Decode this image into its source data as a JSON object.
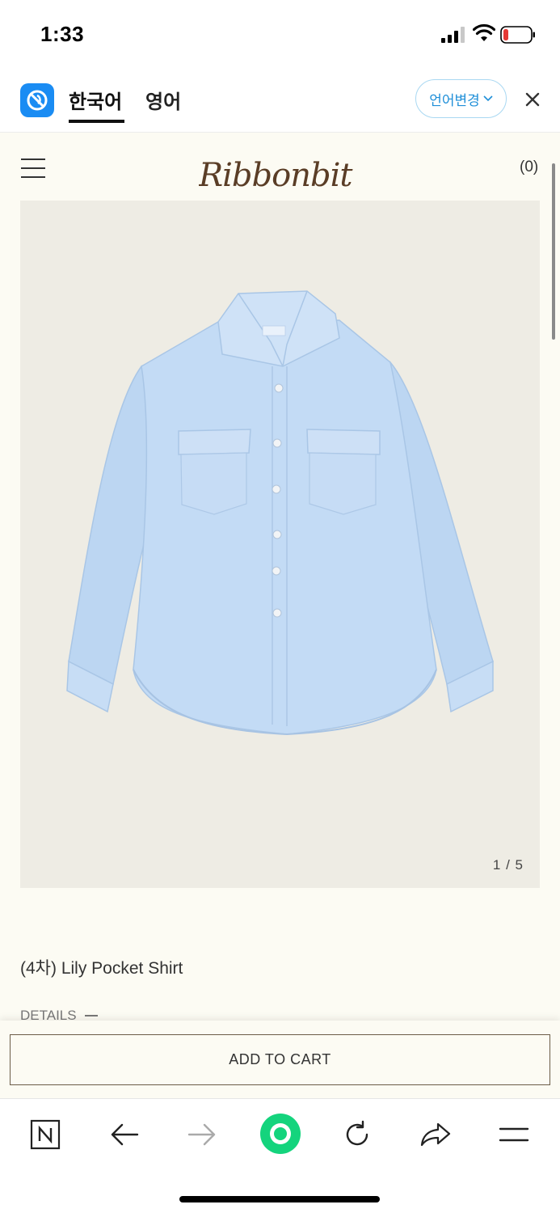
{
  "status_bar": {
    "time": "1:33"
  },
  "translate_bar": {
    "tabs": [
      {
        "label": "한국어",
        "active": true
      },
      {
        "label": "영어",
        "active": false
      }
    ],
    "language_button": "언어변경",
    "close_label": "×"
  },
  "site": {
    "brand": "Ribbonbit",
    "cart_count": "(0)",
    "image_counter": "1 / 5",
    "product_title": "(4차) Lily Pocket Shirt",
    "details_label": "DETAILS",
    "add_to_cart_label": "ADD TO CART"
  },
  "colors": {
    "site_background": "#fcfbf3",
    "image_background": "#eeece4",
    "shirt": "#bfd9f4",
    "brand": "#5a3d26",
    "accent_blue": "#1a8cf3",
    "browser_green": "#14d47d"
  },
  "browser_toolbar": {
    "items": [
      "naver-n-icon",
      "back-arrow-icon",
      "forward-arrow-icon",
      "green-dot-icon",
      "reload-icon",
      "share-icon",
      "menu-icon"
    ]
  }
}
